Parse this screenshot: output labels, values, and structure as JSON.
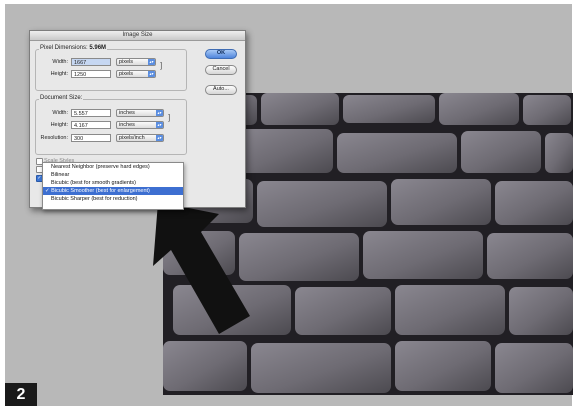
{
  "badge": "2",
  "dialog": {
    "title": "Image Size",
    "pixel_dimensions": {
      "label": "Pixel Dimensions:",
      "size": "5.96M",
      "width_label": "Width:",
      "width_value": "1667",
      "width_unit": "pixels",
      "height_label": "Height:",
      "height_value": "1250",
      "height_unit": "pixels"
    },
    "document_size": {
      "label": "Document Size:",
      "width_label": "Width:",
      "width_value": "5.557",
      "width_unit": "inches",
      "height_label": "Height:",
      "height_value": "4.167",
      "height_unit": "inches",
      "resolution_label": "Resolution:",
      "resolution_value": "300",
      "resolution_unit": "pixels/inch"
    },
    "scale_styles_label": "Scale Styles",
    "buttons": {
      "ok": "OK",
      "cancel": "Cancel",
      "auto": "Auto..."
    }
  },
  "resample_menu": {
    "items": [
      "Nearest Neighbor (preserve hard edges)",
      "Bilinear",
      "Bicubic (best for smooth gradients)",
      "Bicubic Smoother (best for enlargement)",
      "Bicubic Sharper (best for reduction)"
    ],
    "selected": "✓ Bicubic Smoother (best for enlargement)",
    "selected_index": 3
  },
  "colors": {
    "background": "#b8b8b8",
    "menu_highlight": "#3d6fd1",
    "ok_button": "#4f86dc",
    "arrow": "#111111"
  }
}
